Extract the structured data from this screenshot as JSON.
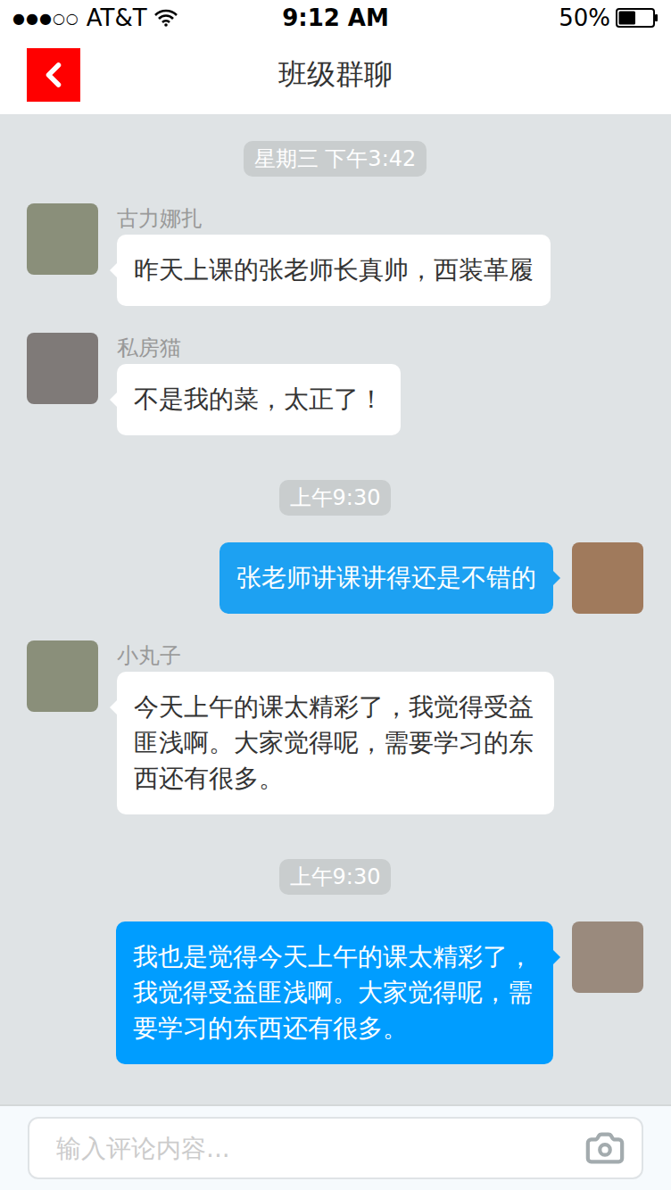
{
  "status_bar": {
    "signal": "●●●○○",
    "carrier": "AT&T",
    "time": "9:12 AM",
    "battery": "50%",
    "battery_level": 0.5
  },
  "nav": {
    "title": "班级群聊"
  },
  "messages": [
    {
      "kind": "time",
      "text": "星期三 下午3:42"
    },
    {
      "kind": "message",
      "side": "left",
      "name": "古力娜扎",
      "text": "昨天上课的张老师长真帅，西装革履",
      "color": "#ffffff"
    },
    {
      "kind": "message",
      "side": "left",
      "name": "私房猫",
      "text": "不是我的菜，太正了！",
      "color": "#ffffff"
    },
    {
      "kind": "time",
      "text": "上午9:30"
    },
    {
      "kind": "message",
      "side": "right",
      "name": "",
      "text": "张老师讲课讲得还是不错的",
      "color": "#1da1f2"
    },
    {
      "kind": "message",
      "side": "left",
      "name": "小丸子",
      "text": "今天上午的课太精彩了，我觉得受益匪浅啊。大家觉得呢，需要学习的东西还有很多。",
      "color": "#ffffff"
    },
    {
      "kind": "time",
      "text": "上午9:30"
    },
    {
      "kind": "message",
      "side": "right",
      "name": "",
      "text": "我也是觉得今天上午的课太精彩了，我觉得受益匪浅啊。大家觉得呢，需要学习的东西还有很多。",
      "color": "#009dff"
    }
  ],
  "composer": {
    "placeholder": "输入评论内容..."
  }
}
